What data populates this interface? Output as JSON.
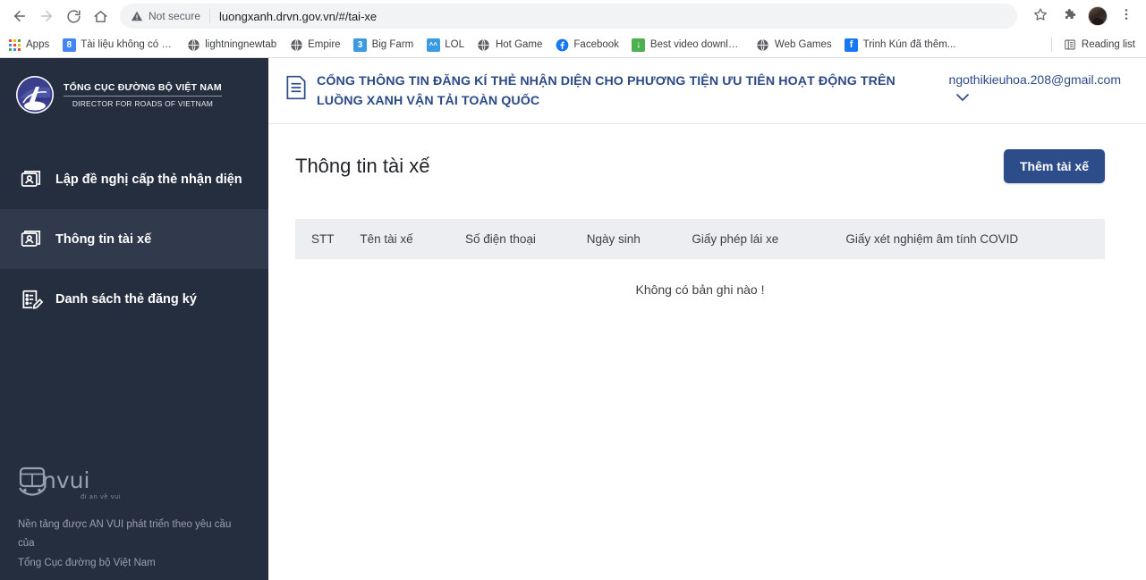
{
  "browser": {
    "nav": {
      "back_icon": "back-arrow-icon",
      "forward_icon": "forward-arrow-icon",
      "reload_icon": "reload-icon",
      "home_icon": "home-icon"
    },
    "omnibox": {
      "security_label": "Not secure",
      "url": "luongxanh.drvn.gov.vn/#/tai-xe"
    },
    "toolbar_right": {
      "bookmark_star_icon": "star-icon",
      "extensions_icon": "puzzle-piece-icon",
      "profile_icon": "avatar-icon",
      "menu_icon": "three-dot-menu-icon"
    },
    "bookmarks": [
      {
        "label": "Apps",
        "icon": "apps-grid-icon",
        "type": "apps"
      },
      {
        "label": "Tài liệu không có ti...",
        "icon": "google-docs-icon",
        "type": "sq",
        "color": "#4285f4",
        "glyph": "8"
      },
      {
        "label": "lightningnewtab",
        "icon": "globe-icon",
        "type": "globe"
      },
      {
        "label": "Empire",
        "icon": "globe-icon",
        "type": "globe"
      },
      {
        "label": "Big Farm",
        "icon": "big-farm-icon",
        "type": "sq",
        "color": "#3b9ae1",
        "glyph": "3"
      },
      {
        "label": "LOL",
        "icon": "lol-face-icon",
        "type": "sq",
        "color": "#3b9ae1",
        "glyph": "^^"
      },
      {
        "label": "Hot Game",
        "icon": "globe-icon",
        "type": "globe"
      },
      {
        "label": "Facebook",
        "icon": "facebook-icon",
        "type": "fb-round"
      },
      {
        "label": "Best video downloa...",
        "icon": "download-icon",
        "type": "sq",
        "color": "#4caf50",
        "glyph": "↓"
      },
      {
        "label": "Web Games",
        "icon": "globe-icon",
        "type": "globe"
      },
      {
        "label": "Trinh Kún đã thêm...",
        "icon": "facebook-icon",
        "type": "sq",
        "color": "#1877f2",
        "glyph": "f"
      }
    ],
    "reading_list": {
      "label": "Reading list",
      "icon": "reading-list-icon"
    }
  },
  "sidebar": {
    "brand": {
      "logo_icon": "drvn-logo-icon",
      "line1": "TỔNG CỤC ĐƯỜNG BỘ VIỆT NAM",
      "line2": "DIRECTOR FOR ROADS OF VIETNAM"
    },
    "items": [
      {
        "label": "Lập đề nghị cấp thẻ nhận diện",
        "icon": "id-card-icon",
        "active": false
      },
      {
        "label": "Thông tin tài xế",
        "icon": "id-card-icon",
        "active": true
      },
      {
        "label": "Danh sách thẻ đăng ký",
        "icon": "list-edit-icon",
        "active": false
      }
    ],
    "footer": {
      "logo_text": "nvui",
      "logo_icon": "anvui-bus-icon",
      "tagline": "đi an về vui",
      "note_line1": "Nền tảng được AN VUI phát triển theo yêu cầu của",
      "note_line2": "Tổng Cục đường bộ Việt Nam"
    }
  },
  "header": {
    "icon": "document-menu-icon",
    "title": "CỔNG THÔNG TIN ĐĂNG KÍ THẺ NHẬN DIỆN CHO PHƯƠNG TIỆN ƯU TIÊN HOẠT ĐỘNG TRÊN LUỒNG XANH VẬN TẢI TOÀN QUỐC",
    "account_email": "ngothikieuhoa.208@gmail.com",
    "account_caret_icon": "chevron-down-icon"
  },
  "main": {
    "page_title": "Thông tin tài xế",
    "add_button_label": "Thêm tài xế",
    "table": {
      "columns": [
        "STT",
        "Tên tài xế",
        "Số điện thoại",
        "Ngày sinh",
        "Giấy phép lái xe",
        "Giấy xét nghiệm âm tính COVID"
      ],
      "empty_message": "Không có bản ghi nào !",
      "rows": []
    }
  },
  "colors": {
    "sidebar_bg": "#252e3f",
    "sidebar_active": "#313a4c",
    "accent": "#2d4c8a",
    "header_text": "#2b4a86",
    "table_header_bg": "#eceef2"
  }
}
